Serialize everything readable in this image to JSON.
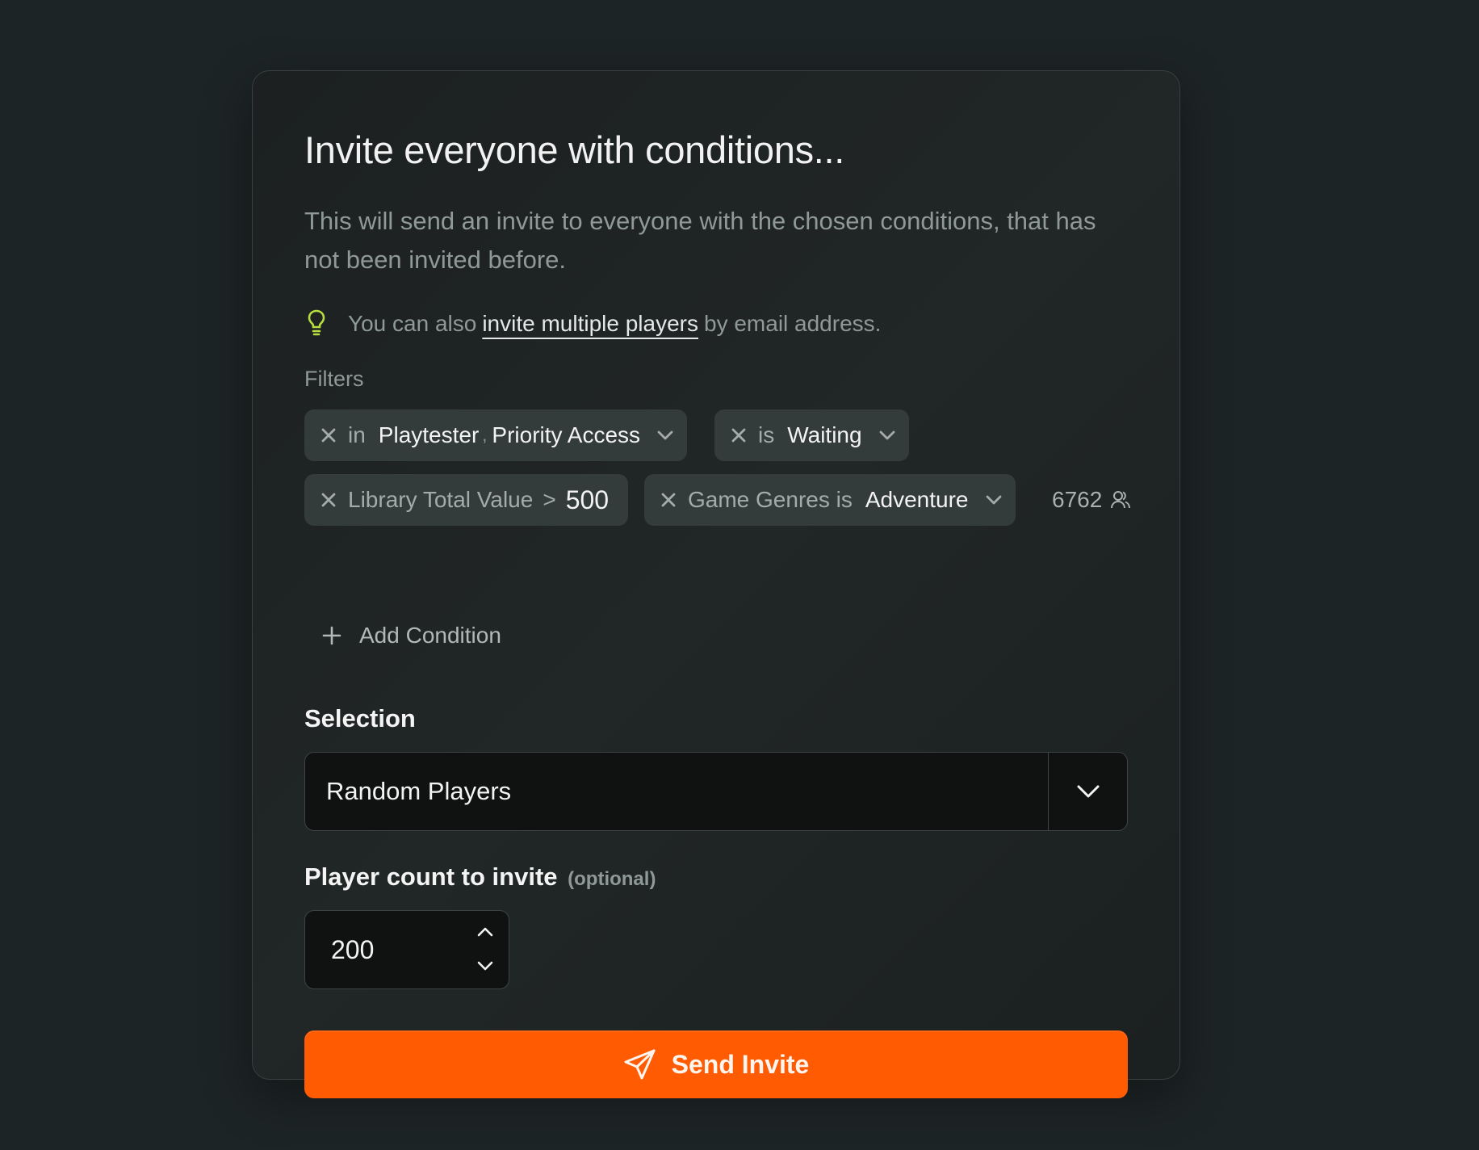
{
  "dialog": {
    "title": "Invite everyone with conditions...",
    "description": "This will send an invite to everyone with the chosen conditions, that has not been invited before.",
    "tip": {
      "prefix": "You can also",
      "link": "invite multiple players",
      "suffix": "by email address."
    }
  },
  "filters": {
    "label": "Filters",
    "chips": [
      {
        "operator": "in",
        "value1": "Playtester",
        "sep": ",",
        "value2": "Priority Access"
      },
      {
        "operator": "is",
        "value": "Waiting"
      },
      {
        "field": "Library Total Value",
        "operator": ">",
        "value": "500"
      },
      {
        "field": "Game Genres is",
        "value": "Adventure"
      }
    ],
    "player_count": "6762",
    "add_condition": "Add Condition"
  },
  "selection": {
    "label": "Selection",
    "value": "Random Players"
  },
  "player_count": {
    "label": "Player count to invite",
    "optional": "(optional)",
    "value": "200"
  },
  "send_button": {
    "label": "Send Invite"
  },
  "colors": {
    "accent": "#fe5b03",
    "background": "#1d2425",
    "tip_icon": "#b6dd3f"
  },
  "icons": {
    "tip": "lightbulb-icon",
    "remove": "close-icon",
    "dropdown": "chevron-down-icon",
    "users": "users-icon",
    "add": "plus-icon",
    "send": "paper-plane-icon"
  }
}
